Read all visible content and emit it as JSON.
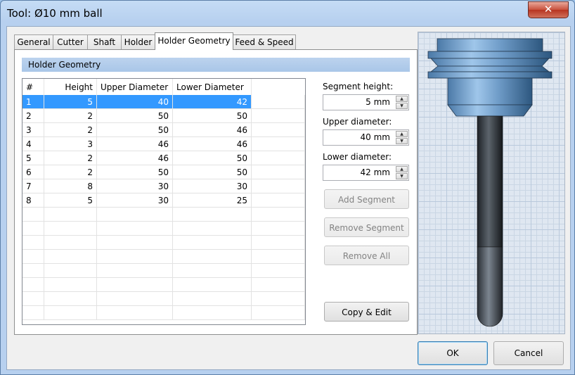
{
  "window": {
    "title": "Tool: Ø10 mm ball",
    "close_glyph": "✕"
  },
  "tabs": [
    {
      "label": "General"
    },
    {
      "label": "Cutter"
    },
    {
      "label": "Shaft"
    },
    {
      "label": "Holder"
    },
    {
      "label": "Holder Geometry",
      "active": true
    },
    {
      "label": "Feed & Speed"
    }
  ],
  "section": {
    "title": "Holder Geometry"
  },
  "table": {
    "headers": [
      "#",
      "Height",
      "Upper Diameter",
      "Lower Diameter"
    ],
    "rows": [
      {
        "n": "1",
        "height": "5",
        "upper": "40",
        "lower": "42"
      },
      {
        "n": "2",
        "height": "2",
        "upper": "50",
        "lower": "50"
      },
      {
        "n": "3",
        "height": "2",
        "upper": "50",
        "lower": "46"
      },
      {
        "n": "4",
        "height": "3",
        "upper": "46",
        "lower": "46"
      },
      {
        "n": "5",
        "height": "2",
        "upper": "46",
        "lower": "50"
      },
      {
        "n": "6",
        "height": "2",
        "upper": "50",
        "lower": "50"
      },
      {
        "n": "7",
        "height": "8",
        "upper": "30",
        "lower": "30"
      },
      {
        "n": "8",
        "height": "5",
        "upper": "30",
        "lower": "25"
      }
    ],
    "selected_row": 0
  },
  "fields": {
    "segment_height": {
      "label": "Segment height:",
      "value": "5 mm"
    },
    "upper_diameter": {
      "label": "Upper diameter:",
      "value": "40 mm"
    },
    "lower_diameter": {
      "label": "Lower diameter:",
      "value": "42 mm"
    }
  },
  "buttons": {
    "add_segment": "Add Segment",
    "remove_segment": "Remove Segment",
    "remove_all": "Remove All",
    "copy_edit": "Copy & Edit",
    "ok": "OK",
    "cancel": "Cancel"
  },
  "colors": {
    "selection": "#3399ff",
    "accent": "#5c8fc0"
  }
}
